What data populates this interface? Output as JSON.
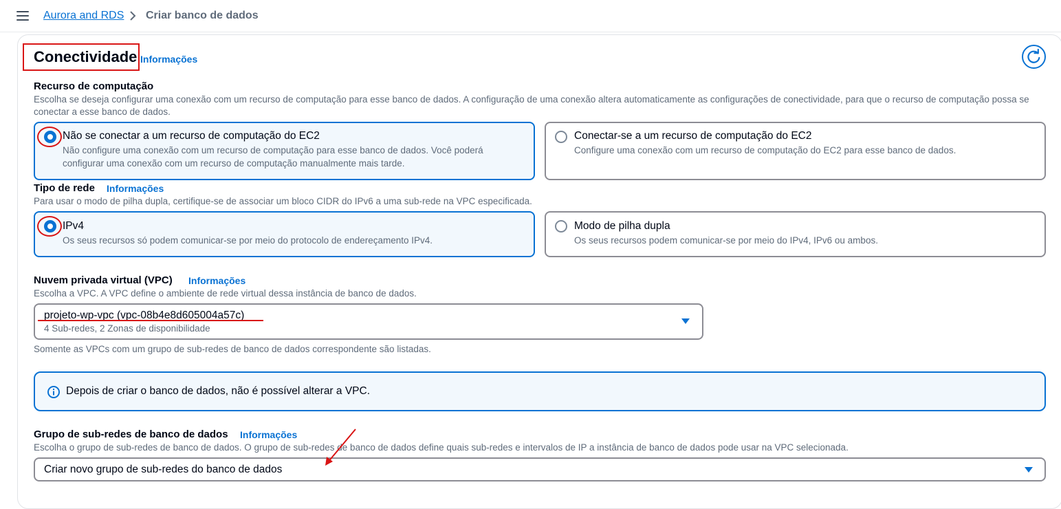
{
  "breadcrumb": {
    "parent": "Aurora and RDS",
    "current": "Criar banco de dados"
  },
  "section": {
    "title": "Conectividade",
    "info": "Informações"
  },
  "compute": {
    "label": "Recurso de computação",
    "description": "Escolha se deseja configurar uma conexão com um recurso de computação para esse banco de dados. A configuração de uma conexão altera automaticamente as configurações de conectividade, para que o recurso de computação possa se conectar a esse banco de dados.",
    "options": [
      {
        "title": "Não se conectar a um recurso de computação do EC2",
        "description": "Não configure uma conexão com um recurso de computação para esse banco de dados. Você poderá configurar uma conexão com um recurso de computação manualmente mais tarde.",
        "selected": true
      },
      {
        "title": "Conectar-se a um recurso de computação do EC2",
        "description": "Configure uma conexão com um recurso de computação do EC2 para esse banco de dados.",
        "selected": false
      }
    ]
  },
  "network": {
    "label": "Tipo de rede",
    "info": "Informações",
    "description": "Para usar o modo de pilha dupla, certifique-se de associar um bloco CIDR do IPv6 a uma sub-rede na VPC especificada.",
    "options": [
      {
        "title": "IPv4",
        "description": "Os seus recursos só podem comunicar-se por meio do protocolo de endereçamento IPv4.",
        "selected": true
      },
      {
        "title": "Modo de pilha dupla",
        "description": "Os seus recursos podem comunicar-se por meio do IPv4, IPv6 ou ambos.",
        "selected": false
      }
    ]
  },
  "vpc": {
    "label": "Nuvem privada virtual (VPC)",
    "info": "Informações",
    "description": "Escolha a VPC. A VPC define o ambiente de rede virtual dessa instância de banco de dados.",
    "selected_value": "projeto-wp-vpc (vpc-08b4e8d605004a57c)",
    "selected_meta": "4 Sub-redes, 2 Zonas de disponibilidade",
    "hint": "Somente as VPCs com um grupo de sub-redes de banco de dados correspondente são listadas."
  },
  "alert": {
    "text": "Depois de criar o banco de dados, não é possível alterar a VPC."
  },
  "subnet_group": {
    "label": "Grupo de sub-redes de banco de dados",
    "info": "Informações",
    "description": "Escolha o grupo de sub-redes de banco de dados. O grupo de sub-redes de banco de dados define quais sub-redes e intervalos de IP a instância de banco de dados pode usar na VPC selecionada.",
    "selected_value": "Criar novo grupo de sub-redes do banco de dados"
  },
  "colors": {
    "accent": "#0972d3",
    "annotation": "#d91515"
  }
}
